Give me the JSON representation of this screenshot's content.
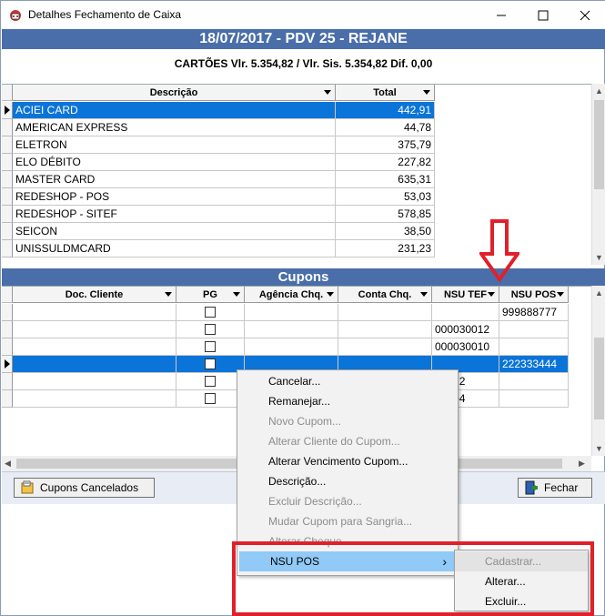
{
  "window": {
    "title": "Detalhes Fechamento de Caixa"
  },
  "header": {
    "title": "18/07/2017 - PDV 25 - REJANE"
  },
  "summary": {
    "text": "CARTÕES Vlr. 5.354,82 / Vlr. Sis. 5.354,82 Dif. 0,00"
  },
  "cards_grid": {
    "columns": [
      "Descrição",
      "Total"
    ],
    "rows": [
      {
        "desc": "ACIEI CARD",
        "total": "442,91"
      },
      {
        "desc": "AMERICAN  EXPRESS",
        "total": "44,78"
      },
      {
        "desc": "ELETRON",
        "total": "375,79"
      },
      {
        "desc": "ELO DÉBITO",
        "total": "227,82"
      },
      {
        "desc": "MASTER CARD",
        "total": "635,31"
      },
      {
        "desc": "REDESHOP - POS",
        "total": "53,03"
      },
      {
        "desc": "REDESHOP - SITEF",
        "total": "578,85"
      },
      {
        "desc": "SEICON",
        "total": "38,50"
      },
      {
        "desc": "UNISSULDMCARD",
        "total": "231,23"
      }
    ]
  },
  "cupons": {
    "title": "Cupons",
    "columns": [
      "Doc. Cliente",
      "PG",
      "Agência Chq.",
      "Conta Chq.",
      "NSU TEF",
      "NSU POS"
    ],
    "rows": [
      {
        "nsu_tef": "",
        "nsu_pos": "999888777"
      },
      {
        "nsu_tef": "000030012",
        "nsu_pos": ""
      },
      {
        "nsu_tef": "000030010",
        "nsu_pos": ""
      },
      {
        "nsu_tef": "",
        "nsu_pos": "222333444"
      },
      {
        "nsu_tef": "30012",
        "nsu_pos": ""
      },
      {
        "nsu_tef": "30004",
        "nsu_pos": ""
      }
    ]
  },
  "buttons": {
    "cupons_cancelados": "Cupons Cancelados",
    "fechar": "Fechar"
  },
  "context_menu": {
    "items": [
      {
        "label": "Cancelar...",
        "enabled": true
      },
      {
        "label": "Remanejar...",
        "enabled": true
      },
      {
        "label": "Novo Cupom...",
        "enabled": false
      },
      {
        "label": "Alterar Cliente do Cupom...",
        "enabled": false
      },
      {
        "label": "Alterar Vencimento Cupom...",
        "enabled": true
      },
      {
        "label": "Descrição...",
        "enabled": true
      },
      {
        "label": "Excluir Descrição...",
        "enabled": false
      },
      {
        "label": "Mudar Cupom para Sangria...",
        "enabled": false
      },
      {
        "label": "Alterar Cheque",
        "enabled": false
      },
      {
        "label": "NSU POS",
        "enabled": true,
        "submenu": true
      }
    ],
    "submenu": [
      {
        "label": "Cadastrar...",
        "enabled": false
      },
      {
        "label": "Alterar...",
        "enabled": true
      },
      {
        "label": "Excluir...",
        "enabled": true
      }
    ]
  },
  "colors": {
    "header_blue": "#4a6ea9",
    "selection_blue": "#0b74d8",
    "menu_highlight": "#91c9f7",
    "annotation_red": "#e0202a"
  }
}
